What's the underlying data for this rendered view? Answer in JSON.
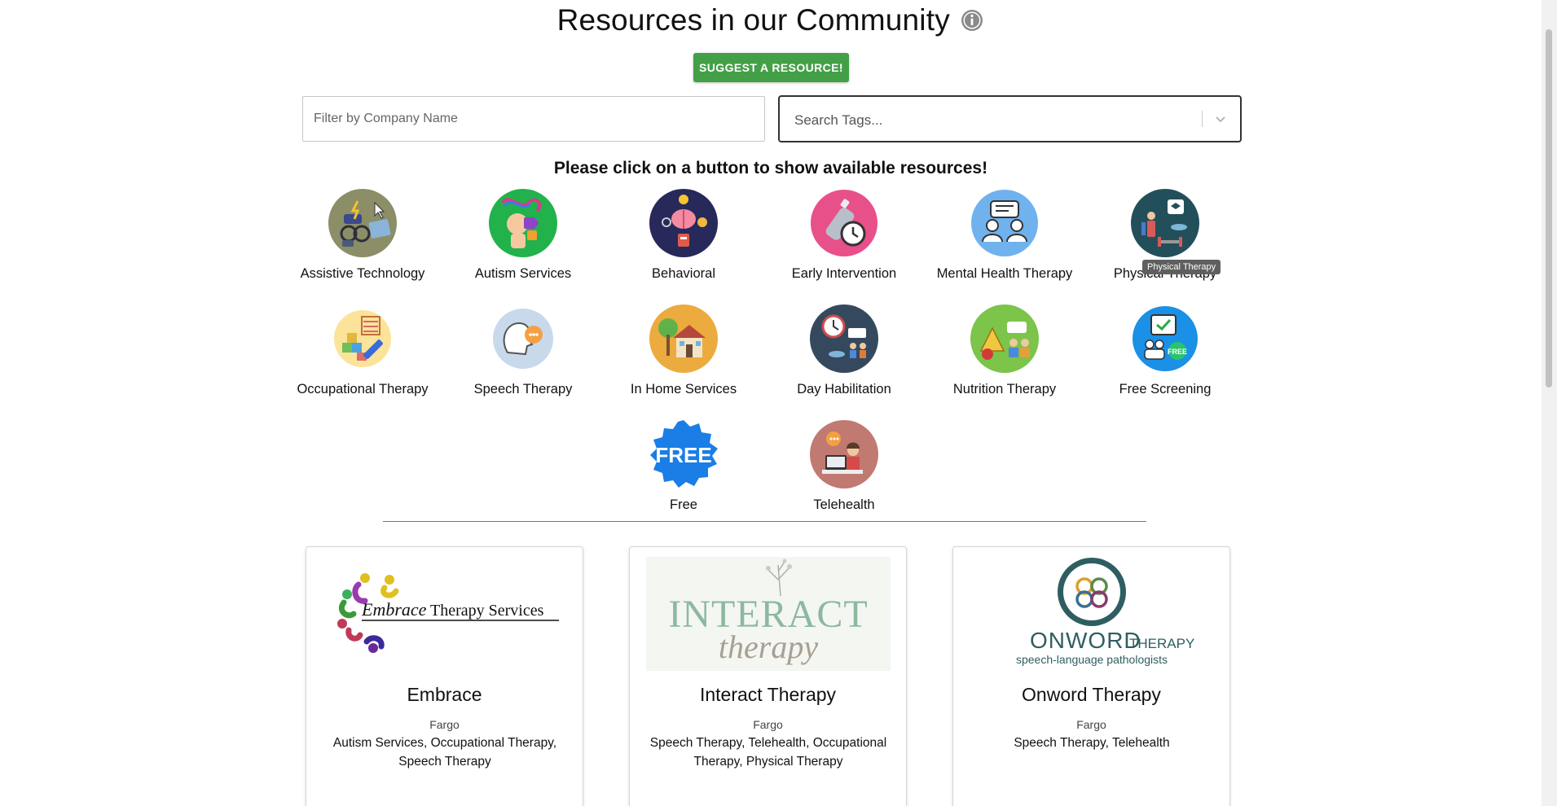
{
  "header": {
    "title": "Resources in our Community",
    "info_icon": "info-circle-icon",
    "suggest_label": "SUGGEST A RESOURCE!",
    "accent_color": "#43a047"
  },
  "filters": {
    "company_placeholder": "Filter by Company Name",
    "tags_placeholder": "Search Tags...",
    "tags_chevron_icon": "chevron-down-icon"
  },
  "prompt": "Please click on a button to show available resources!",
  "categories": [
    {
      "label": "Assistive Technology",
      "icon": "wheelchair-device-icon"
    },
    {
      "label": "Autism Services",
      "icon": "puzzle-head-icon"
    },
    {
      "label": "Behavioral",
      "icon": "brain-icon"
    },
    {
      "label": "Early Intervention",
      "icon": "baby-bottle-clock-icon"
    },
    {
      "label": "Mental Health Therapy",
      "icon": "chat-people-icon"
    },
    {
      "label": "Physical Therapy",
      "icon": "exercise-icon"
    },
    {
      "label": "Occupational Therapy",
      "icon": "abc-blocks-icon"
    },
    {
      "label": "Speech Therapy",
      "icon": "speaking-head-icon"
    },
    {
      "label": "In Home Services",
      "icon": "house-icon"
    },
    {
      "label": "Day Habilitation",
      "icon": "clock-group-icon"
    },
    {
      "label": "Nutrition Therapy",
      "icon": "food-chat-icon"
    },
    {
      "label": "Free Screening",
      "icon": "screening-check-icon"
    },
    {
      "label": "Free",
      "icon": "free-badge-icon"
    },
    {
      "label": "Telehealth",
      "icon": "computer-person-icon"
    }
  ],
  "tooltip": "Physical Therapy",
  "cards": [
    {
      "name": "Embrace",
      "city": "Fargo",
      "tags": "Autism Services, Occupational Therapy, Speech Therapy",
      "logo_text": "Embrace Therapy Services"
    },
    {
      "name": "Interact Therapy",
      "city": "Fargo",
      "tags": "Speech Therapy, Telehealth, Occupational Therapy, Physical Therapy",
      "logo_text": "INTERACT therapy"
    },
    {
      "name": "Onword Therapy",
      "city": "Fargo",
      "tags": "Speech Therapy, Telehealth",
      "logo_text": "ONWORD THERAPY speech-language pathologists"
    }
  ]
}
